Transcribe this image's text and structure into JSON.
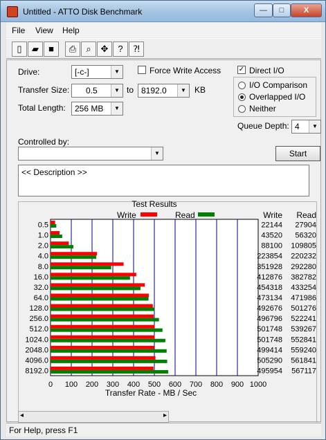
{
  "window": {
    "title": "Untitled - ATTO Disk Benchmark",
    "caption_buttons": {
      "minimize": "—",
      "maximize": "□",
      "close": "X"
    }
  },
  "menu": [
    "File",
    "View",
    "Help"
  ],
  "toolbar_icons": [
    "new-icon",
    "open-icon",
    "save-icon",
    "print-icon",
    "print-preview-icon",
    "move-icon",
    "help-icon",
    "context-help-icon"
  ],
  "form": {
    "drive_label": "Drive:",
    "drive_value": "[-c-]",
    "force_write_label": "Force Write Access",
    "force_write_checked": false,
    "direct_io_label": "Direct I/O",
    "direct_io_checked": true,
    "transfer_size_label": "Transfer Size:",
    "transfer_from": "0.5",
    "transfer_to_label": "to",
    "transfer_to": "8192.0",
    "transfer_unit": "KB",
    "total_length_label": "Total Length:",
    "total_length_value": "256 MB",
    "io_modes": [
      {
        "label": "I/O Comparison",
        "selected": false
      },
      {
        "label": "Overlapped I/O",
        "selected": true
      },
      {
        "label": "Neither",
        "selected": false
      }
    ],
    "queue_depth_label": "Queue Depth:",
    "queue_depth_value": "4",
    "controlled_by_label": "Controlled by:",
    "controlled_by_value": "",
    "start_label": "Start",
    "description": "<< Description >>"
  },
  "chart_data": {
    "type": "bar",
    "title": "Test Results",
    "xlabel": "Transfer Rate - MB / Sec",
    "xlim": [
      0,
      1000
    ],
    "x_ticks": [
      "0",
      "100",
      "200",
      "300",
      "400",
      "500",
      "600",
      "700",
      "800",
      "900",
      "1000"
    ],
    "categories": [
      "0.5",
      "1.0",
      "2.0",
      "4.0",
      "8.0",
      "16.0",
      "32.0",
      "64.0",
      "128.0",
      "256.0",
      "512.0",
      "1024.0",
      "2048.0",
      "4096.0",
      "8192.0"
    ],
    "legend": [
      "Write",
      "Read"
    ],
    "colors": {
      "write": "#ff0000",
      "read": "#008000"
    },
    "series": [
      {
        "name": "Write",
        "values": [
          22144,
          43520,
          88100,
          223854,
          351928,
          412876,
          454318,
          473134,
          492676,
          496796,
          501748,
          501748,
          499414,
          505290,
          495954
        ]
      },
      {
        "name": "Read",
        "values": [
          27904,
          56320,
          109805,
          220232,
          292280,
          382782,
          433254,
          471986,
          501276,
          522241,
          539267,
          552841,
          559240,
          561841,
          567117
        ]
      }
    ],
    "table_headers": [
      "Write",
      "Read"
    ]
  },
  "status": "For Help, press F1"
}
